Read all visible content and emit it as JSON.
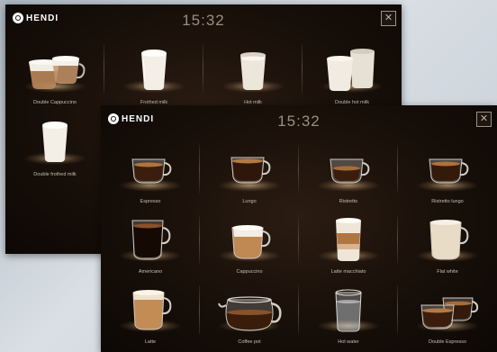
{
  "brand": {
    "name": "HENDI"
  },
  "back_screen": {
    "time": "15:32",
    "tiles": [
      {
        "label": "Double Cappuccino",
        "icon": "double-cappuccino-icon"
      },
      {
        "label": "Frothed milk",
        "icon": "frothed-milk-glass-icon"
      },
      {
        "label": "Hot milk",
        "icon": "hot-milk-glass-icon"
      },
      {
        "label": "Double hot milk",
        "icon": "double-hot-milk-icon"
      },
      {
        "label": "Double frothed milk",
        "icon": "double-frothed-milk-icon"
      }
    ]
  },
  "front_screen": {
    "time": "15:32",
    "tiles": [
      {
        "label": "Espresso",
        "icon": "espresso-cup-icon"
      },
      {
        "label": "Lungo",
        "icon": "lungo-cup-icon"
      },
      {
        "label": "Ristretto",
        "icon": "ristretto-cup-icon"
      },
      {
        "label": "Ristretto lungo",
        "icon": "ristretto-lungo-cup-icon"
      },
      {
        "label": "Americano",
        "icon": "americano-glass-icon"
      },
      {
        "label": "Cappuccino",
        "icon": "cappuccino-cup-icon"
      },
      {
        "label": "Latte macchiato",
        "icon": "latte-macchiato-glass-icon"
      },
      {
        "label": "Flat white",
        "icon": "flat-white-glass-icon"
      },
      {
        "label": "Latte",
        "icon": "latte-glass-icon"
      },
      {
        "label": "Coffee pot",
        "icon": "coffee-pot-icon"
      },
      {
        "label": "Hot water",
        "icon": "hot-water-glass-icon"
      },
      {
        "label": "Double Espresso",
        "icon": "double-espresso-icon"
      }
    ]
  }
}
